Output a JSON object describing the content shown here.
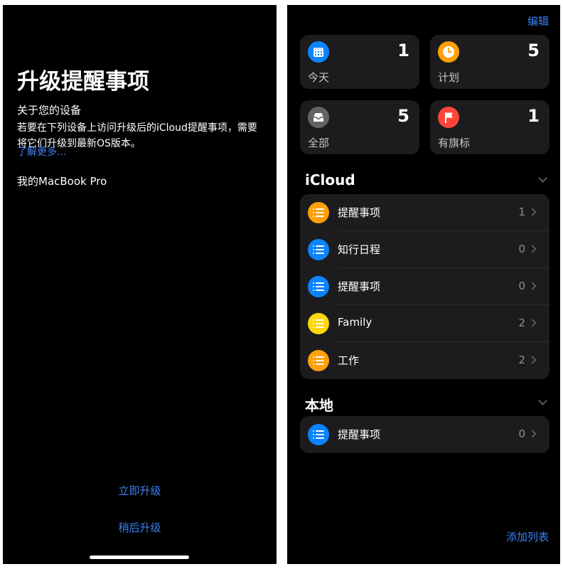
{
  "upgrade_screen": {
    "title": "升级提醒事项",
    "subtitle": "关于您的设备",
    "body": "若要在下列设备上访问升级后的iCloud提醒事项，需要将它们升级到最新OS版本。",
    "learn_more": "了解更多...",
    "device": "我的MacBook Pro",
    "upgrade_now": "立即升级",
    "upgrade_later": "稍后升级"
  },
  "reminders": {
    "edit_label": "编辑",
    "smart_lists": [
      {
        "label": "今天",
        "count": "1",
        "icon": "calendar-icon",
        "color": "#0a84ff"
      },
      {
        "label": "计划",
        "count": "5",
        "icon": "clock-icon",
        "color": "#ff9f0a"
      },
      {
        "label": "全部",
        "count": "5",
        "icon": "tray-icon",
        "color": "#636366"
      },
      {
        "label": "有旗标",
        "count": "1",
        "icon": "flag-icon",
        "color": "#ff453a"
      }
    ],
    "icloud": {
      "header": "iCloud",
      "lists": [
        {
          "label": "提醒事项",
          "count": "1",
          "color": "#ff9f0a"
        },
        {
          "label": "知行日程",
          "count": "0",
          "color": "#0a84ff"
        },
        {
          "label": "提醒事项",
          "count": "0",
          "color": "#0a84ff"
        },
        {
          "label": "Family",
          "count": "2",
          "color": "#ffd60a"
        },
        {
          "label": "工作",
          "count": "2",
          "color": "#ff9f0a"
        }
      ]
    },
    "local": {
      "header": "本地",
      "lists": [
        {
          "label": "提醒事项",
          "count": "0",
          "color": "#0a84ff"
        }
      ]
    },
    "add_list": "添加列表"
  },
  "accent_color": "#3b82f6"
}
